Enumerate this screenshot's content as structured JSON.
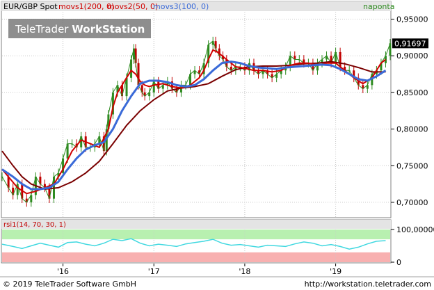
{
  "header": {
    "legend_main": "EUR/GBP Spot",
    "legend_ma1": "movs1(200, 0)",
    "legend_ma2": "movs2(50, 0)",
    "legend_ma3": "movs3(100, 0)",
    "period_label": "naponta"
  },
  "watermark": {
    "part1": "TeleTrader",
    "part2": "WorkStation"
  },
  "footer": {
    "copyright": "© 2019 TeleTrader Software GmbH",
    "url": "http://workstation.teletrader.com"
  },
  "colors": {
    "background": "#ffffff",
    "grid": "#c8c8c8",
    "header_bar": "#e4e4e4",
    "ma_200": "#7a0000",
    "ma_50": "#d00000",
    "ma_100": "#3a6ad8",
    "candle_up": "#2e8b20",
    "candle_down": "#c00000",
    "rsi_line": "#40d8e0",
    "rsi_upper_zone": "#b8f0b0",
    "rsi_lower_zone": "#f8b0b0",
    "last_price_box": "#000000"
  },
  "chart_data": [
    {
      "type": "line",
      "ylim": [
        0.68,
        0.96
      ],
      "y_ticks": [
        "0,95000",
        "0,90000",
        "0,85000",
        "0,80000",
        "0,75000",
        "0,70000"
      ],
      "y_tick_values": [
        0.95,
        0.9,
        0.85,
        0.8,
        0.75,
        0.7
      ],
      "last_price": "0,91697",
      "last_price_value": 0.91697,
      "x_ticks": [
        "'16",
        "'17",
        "'18",
        "'19"
      ],
      "x_tick_values": [
        2016.0,
        2017.0,
        2018.0,
        2019.0
      ],
      "xlim": [
        2015.33,
        2019.6
      ],
      "series": [
        {
          "name": "EUR/GBP Spot",
          "x": [
            2015.33,
            2015.4,
            2015.45,
            2015.5,
            2015.55,
            2015.6,
            2015.65,
            2015.7,
            2015.75,
            2015.8,
            2015.85,
            2015.9,
            2015.95,
            2016.0,
            2016.05,
            2016.1,
            2016.15,
            2016.2,
            2016.25,
            2016.3,
            2016.35,
            2016.4,
            2016.45,
            2016.48,
            2016.5,
            2016.55,
            2016.6,
            2016.65,
            2016.7,
            2016.75,
            2016.78,
            2016.8,
            2016.83,
            2016.87,
            2016.9,
            2016.95,
            2017.0,
            2017.05,
            2017.1,
            2017.15,
            2017.2,
            2017.25,
            2017.3,
            2017.35,
            2017.4,
            2017.45,
            2017.5,
            2017.55,
            2017.6,
            2017.65,
            2017.68,
            2017.72,
            2017.76,
            2017.8,
            2017.85,
            2017.9,
            2017.95,
            2018.0,
            2018.05,
            2018.1,
            2018.15,
            2018.2,
            2018.25,
            2018.3,
            2018.35,
            2018.4,
            2018.45,
            2018.5,
            2018.55,
            2018.6,
            2018.65,
            2018.7,
            2018.75,
            2018.8,
            2018.85,
            2018.9,
            2018.95,
            2019.0,
            2019.05,
            2019.1,
            2019.15,
            2019.2,
            2019.25,
            2019.3,
            2019.35,
            2019.4,
            2019.45,
            2019.5,
            2019.55,
            2019.6
          ],
          "values": [
            0.735,
            0.72,
            0.71,
            0.725,
            0.705,
            0.7,
            0.71,
            0.735,
            0.725,
            0.72,
            0.705,
            0.735,
            0.74,
            0.76,
            0.78,
            0.78,
            0.775,
            0.79,
            0.775,
            0.775,
            0.78,
            0.79,
            0.77,
            0.8,
            0.82,
            0.85,
            0.86,
            0.845,
            0.87,
            0.895,
            0.91,
            0.89,
            0.86,
            0.85,
            0.845,
            0.85,
            0.865,
            0.855,
            0.86,
            0.865,
            0.855,
            0.85,
            0.86,
            0.86,
            0.875,
            0.88,
            0.875,
            0.89,
            0.915,
            0.92,
            0.91,
            0.9,
            0.895,
            0.885,
            0.88,
            0.885,
            0.885,
            0.88,
            0.89,
            0.88,
            0.875,
            0.88,
            0.875,
            0.87,
            0.875,
            0.88,
            0.885,
            0.9,
            0.895,
            0.895,
            0.89,
            0.89,
            0.88,
            0.89,
            0.895,
            0.9,
            0.89,
            0.905,
            0.885,
            0.88,
            0.88,
            0.87,
            0.86,
            0.855,
            0.86,
            0.875,
            0.88,
            0.89,
            0.9,
            0.917
          ]
        },
        {
          "name": "movs1(200, 0)",
          "x": [
            2015.33,
            2015.45,
            2015.55,
            2015.65,
            2015.8,
            2015.95,
            2016.1,
            2016.25,
            2016.4,
            2016.55,
            2016.7,
            2016.85,
            2017.0,
            2017.15,
            2017.3,
            2017.45,
            2017.6,
            2017.75,
            2017.9,
            2018.05,
            2018.2,
            2018.35,
            2018.5,
            2018.65,
            2018.8,
            2018.95,
            2019.1,
            2019.25,
            2019.4,
            2019.55
          ],
          "values": [
            0.77,
            0.75,
            0.735,
            0.725,
            0.718,
            0.72,
            0.728,
            0.74,
            0.756,
            0.78,
            0.805,
            0.825,
            0.84,
            0.852,
            0.856,
            0.858,
            0.862,
            0.872,
            0.881,
            0.885,
            0.886,
            0.886,
            0.887,
            0.889,
            0.89,
            0.892,
            0.889,
            0.884,
            0.878,
            0.878
          ]
        },
        {
          "name": "movs2(50, 0)",
          "x": [
            2015.33,
            2015.4,
            2015.5,
            2015.6,
            2015.7,
            2015.8,
            2015.9,
            2016.0,
            2016.1,
            2016.2,
            2016.3,
            2016.4,
            2016.5,
            2016.55,
            2016.6,
            2016.65,
            2016.7,
            2016.75,
            2016.8,
            2016.85,
            2016.9,
            2016.95,
            2017.0,
            2017.1,
            2017.2,
            2017.3,
            2017.4,
            2017.5,
            2017.55,
            2017.6,
            2017.65,
            2017.7,
            2017.8,
            2017.9,
            2018.0,
            2018.1,
            2018.2,
            2018.3,
            2018.4,
            2018.5,
            2018.6,
            2018.7,
            2018.8,
            2018.9,
            2019.0,
            2019.1,
            2019.2,
            2019.3,
            2019.4,
            2019.5,
            2019.55
          ],
          "values": [
            0.745,
            0.735,
            0.72,
            0.712,
            0.715,
            0.72,
            0.725,
            0.745,
            0.77,
            0.785,
            0.78,
            0.775,
            0.8,
            0.83,
            0.85,
            0.86,
            0.87,
            0.88,
            0.875,
            0.865,
            0.86,
            0.858,
            0.86,
            0.862,
            0.858,
            0.856,
            0.86,
            0.87,
            0.88,
            0.895,
            0.908,
            0.905,
            0.895,
            0.885,
            0.883,
            0.88,
            0.88,
            0.878,
            0.88,
            0.887,
            0.89,
            0.89,
            0.887,
            0.89,
            0.89,
            0.88,
            0.87,
            0.862,
            0.87,
            0.89,
            0.895
          ]
        },
        {
          "name": "movs3(100, 0)",
          "x": [
            2015.33,
            2015.45,
            2015.55,
            2015.65,
            2015.75,
            2015.85,
            2015.95,
            2016.05,
            2016.15,
            2016.25,
            2016.35,
            2016.45,
            2016.55,
            2016.65,
            2016.75,
            2016.85,
            2016.95,
            2017.05,
            2017.15,
            2017.25,
            2017.35,
            2017.45,
            2017.55,
            2017.65,
            2017.75,
            2017.85,
            2017.95,
            2018.05,
            2018.15,
            2018.25,
            2018.35,
            2018.45,
            2018.55,
            2018.65,
            2018.75,
            2018.85,
            2018.95,
            2019.05,
            2019.15,
            2019.25,
            2019.35,
            2019.45,
            2019.55
          ],
          "values": [
            0.745,
            0.735,
            0.725,
            0.718,
            0.718,
            0.72,
            0.728,
            0.745,
            0.76,
            0.772,
            0.778,
            0.782,
            0.8,
            0.825,
            0.845,
            0.862,
            0.866,
            0.866,
            0.864,
            0.86,
            0.858,
            0.86,
            0.868,
            0.88,
            0.89,
            0.892,
            0.89,
            0.886,
            0.884,
            0.883,
            0.882,
            0.884,
            0.885,
            0.886,
            0.887,
            0.888,
            0.887,
            0.882,
            0.875,
            0.868,
            0.866,
            0.872,
            0.88
          ]
        }
      ]
    },
    {
      "type": "line",
      "title": "rsi1(14, 70, 30, 1)",
      "ylim": [
        0,
        100
      ],
      "y_ticks": [
        "100,00000",
        "0"
      ],
      "y_tick_values": [
        100,
        0
      ],
      "upper_band": 70,
      "lower_band": 30,
      "series": [
        {
          "name": "rsi1(14, 70, 30, 1)",
          "x": [
            2015.33,
            2015.45,
            2015.55,
            2015.65,
            2015.75,
            2015.85,
            2015.95,
            2016.05,
            2016.15,
            2016.25,
            2016.35,
            2016.45,
            2016.55,
            2016.65,
            2016.75,
            2016.85,
            2016.95,
            2017.05,
            2017.15,
            2017.25,
            2017.35,
            2017.45,
            2017.55,
            2017.65,
            2017.75,
            2017.85,
            2017.95,
            2018.05,
            2018.15,
            2018.25,
            2018.35,
            2018.45,
            2018.55,
            2018.65,
            2018.75,
            2018.85,
            2018.95,
            2019.05,
            2019.15,
            2019.25,
            2019.35,
            2019.45,
            2019.55
          ],
          "values": [
            55,
            48,
            42,
            50,
            58,
            52,
            46,
            60,
            62,
            55,
            50,
            58,
            70,
            66,
            72,
            58,
            50,
            55,
            52,
            48,
            56,
            60,
            64,
            70,
            58,
            52,
            54,
            50,
            46,
            52,
            50,
            48,
            56,
            62,
            58,
            50,
            54,
            48,
            40,
            46,
            56,
            64,
            66
          ]
        }
      ]
    }
  ]
}
